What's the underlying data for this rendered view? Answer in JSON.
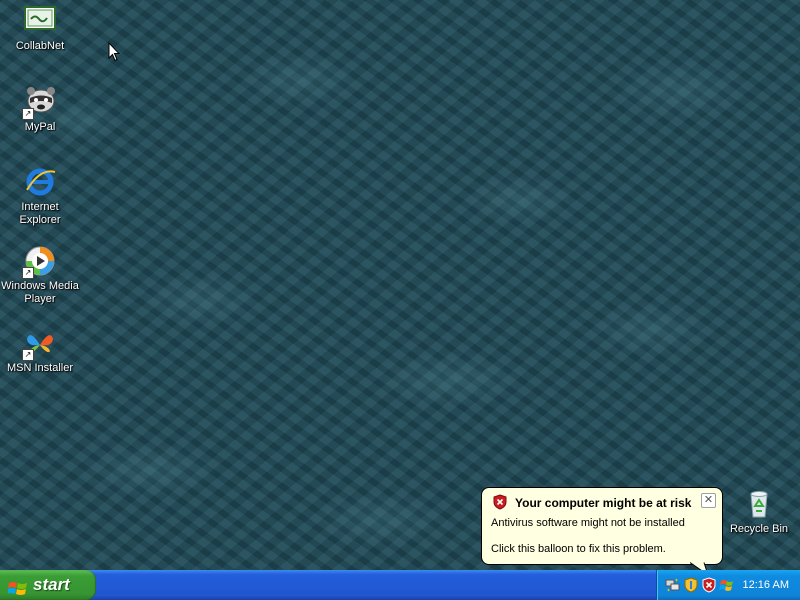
{
  "desktop": {
    "icons": [
      {
        "label": "CollabNet"
      },
      {
        "label": "MyPal"
      },
      {
        "label": "Internet Explorer"
      },
      {
        "label": "Windows Media Player"
      },
      {
        "label": "MSN Installer"
      },
      {
        "label": "Recycle Bin"
      }
    ]
  },
  "taskbar": {
    "start_label": "start",
    "clock": "12:16 AM"
  },
  "balloon": {
    "title": "Your computer might be at risk",
    "line1": "Antivirus software might not be installed",
    "line2": "Click this balloon to fix this problem.",
    "close_glyph": "✕"
  },
  "colors": {
    "taskbar": "#245edb",
    "start_button": "#3a9d35",
    "tray": "#0f8be0",
    "balloon_bg": "#ffffe1",
    "desktop_bg": "#1f4a57"
  }
}
